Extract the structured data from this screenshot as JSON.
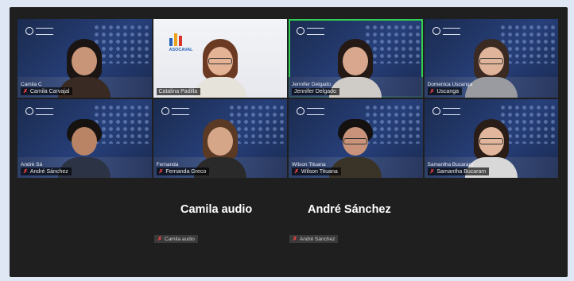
{
  "meeting": {
    "tiles": [
      {
        "name": "Camila Carvajal",
        "caption": "Camila C",
        "mic_muted": true,
        "active": false
      },
      {
        "name": "Catalina Padilla",
        "caption": "",
        "mic_muted": false,
        "active": false,
        "org_logo": "ASOCAVAL"
      },
      {
        "name": "Jennifer Delgado",
        "caption": "Jennifer Delgado",
        "mic_muted": false,
        "active": true
      },
      {
        "name": "Uscanga",
        "caption": "Domenica Uscanga",
        "mic_muted": true,
        "active": false
      },
      {
        "name": "André Sánchez",
        "caption": "André Sá",
        "mic_muted": true,
        "active": false
      },
      {
        "name": "Fernanda Greco",
        "caption": "Fernanda",
        "mic_muted": true,
        "active": false
      },
      {
        "name": "Wilson Tituana",
        "caption": "Wilson Tituana",
        "mic_muted": true,
        "active": false
      },
      {
        "name": "Samantha Bucaram",
        "caption": "Samantha Bucaram",
        "mic_muted": true,
        "active": false
      }
    ],
    "audio_only": [
      {
        "name": "Camila audio",
        "label": "Camila audio"
      },
      {
        "name": "André Sánchez",
        "label": "André Sánchez"
      }
    ]
  }
}
